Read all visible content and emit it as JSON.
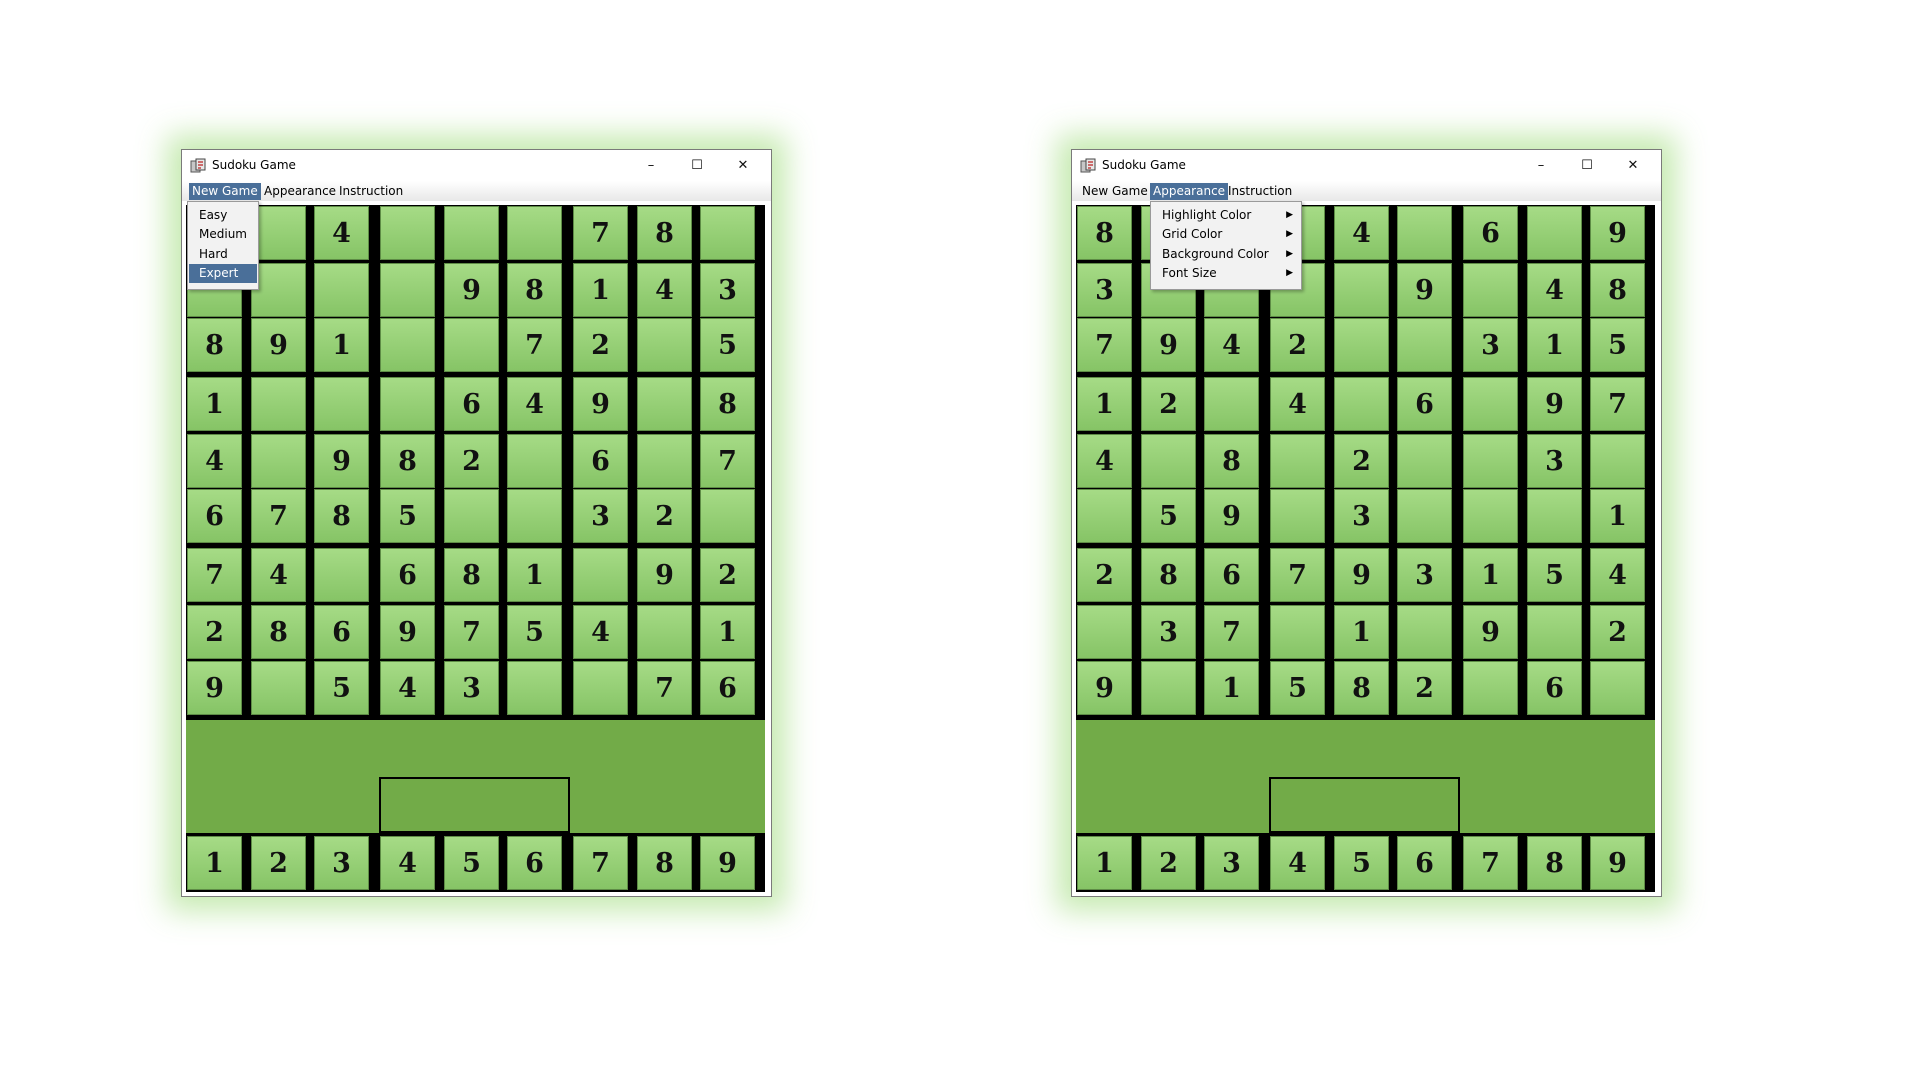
{
  "windows": [
    {
      "title": "Sudoku Game",
      "menus": [
        "New Game",
        "Appearance",
        "Instruction"
      ],
      "active_menu": 0,
      "dropdown": {
        "items": [
          {
            "label": "Easy",
            "submenu": false
          },
          {
            "label": "Medium",
            "submenu": false
          },
          {
            "label": "Hard",
            "submenu": false
          },
          {
            "label": "Expert",
            "submenu": false
          }
        ],
        "selected": 3
      },
      "grid": [
        [
          "",
          "",
          "4",
          "",
          "",
          "",
          "7",
          "8",
          ""
        ],
        [
          "",
          "",
          "",
          "",
          "9",
          "8",
          "1",
          "4",
          "3"
        ],
        [
          "8",
          "9",
          "1",
          "",
          "",
          "7",
          "2",
          "",
          "5"
        ],
        [
          "1",
          "",
          "",
          "",
          "6",
          "4",
          "9",
          "",
          "8"
        ],
        [
          "4",
          "",
          "9",
          "8",
          "2",
          "",
          "6",
          "",
          "7"
        ],
        [
          "6",
          "7",
          "8",
          "5",
          "",
          "",
          "3",
          "2",
          ""
        ],
        [
          "7",
          "4",
          "",
          "6",
          "8",
          "1",
          "",
          "9",
          "2"
        ],
        [
          "2",
          "8",
          "6",
          "9",
          "7",
          "5",
          "4",
          "",
          "1"
        ],
        [
          "9",
          "",
          "5",
          "4",
          "3",
          "",
          "",
          "7",
          "6"
        ]
      ],
      "number_pad": [
        "1",
        "2",
        "3",
        "4",
        "5",
        "6",
        "7",
        "8",
        "9"
      ]
    },
    {
      "title": "Sudoku Game",
      "menus": [
        "New Game",
        "Appearance",
        "Instruction"
      ],
      "active_menu": 1,
      "dropdown": {
        "items": [
          {
            "label": "Highlight Color",
            "submenu": true
          },
          {
            "label": "Grid Color",
            "submenu": true
          },
          {
            "label": "Background Color",
            "submenu": true
          },
          {
            "label": "Font Size",
            "submenu": true
          }
        ],
        "selected": -1
      },
      "grid": [
        [
          "8",
          "",
          "",
          "",
          "4",
          "",
          "6",
          "",
          "9"
        ],
        [
          "3",
          "",
          "",
          "",
          "",
          "9",
          "",
          "4",
          "8"
        ],
        [
          "7",
          "9",
          "4",
          "2",
          "",
          "",
          "3",
          "1",
          "5"
        ],
        [
          "1",
          "2",
          "",
          "4",
          "",
          "6",
          "",
          "9",
          "7"
        ],
        [
          "4",
          "",
          "8",
          "",
          "2",
          "",
          "",
          "3",
          ""
        ],
        [
          "",
          "5",
          "9",
          "",
          "3",
          "",
          "",
          "",
          "1"
        ],
        [
          "2",
          "8",
          "6",
          "7",
          "9",
          "3",
          "1",
          "5",
          "4"
        ],
        [
          "",
          "3",
          "7",
          "",
          "1",
          "",
          "9",
          "",
          "2"
        ],
        [
          "9",
          "",
          "1",
          "5",
          "8",
          "2",
          "",
          "6",
          ""
        ]
      ],
      "number_pad": [
        "1",
        "2",
        "3",
        "4",
        "5",
        "6",
        "7",
        "8",
        "9"
      ]
    }
  ],
  "icons": {
    "app": "sudoku-app-icon",
    "minimize": "minimize-icon",
    "maximize": "maximize-icon",
    "close": "close-icon",
    "submenu": "submenu-arrow-icon"
  },
  "colors": {
    "cell_top": "#a6db86",
    "cell_bottom": "#86c466",
    "panel": "#72ab48",
    "menu_highlight": "#4a6f99",
    "window_glow": "#78cd46",
    "grid_line": "#000000"
  }
}
